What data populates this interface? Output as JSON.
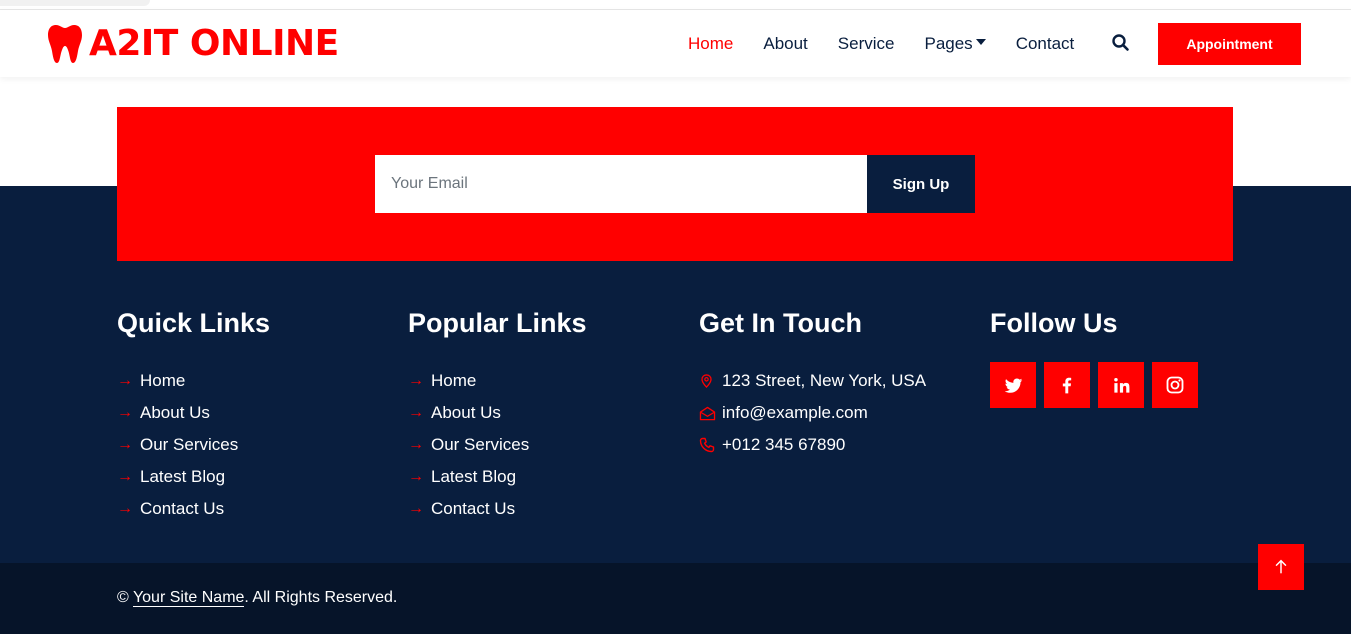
{
  "brand": {
    "name": "A2IT ONLINE",
    "icon": "tooth-icon",
    "color": "#ff0000"
  },
  "nav": {
    "items": [
      {
        "label": "Home",
        "active": true
      },
      {
        "label": "About",
        "active": false
      },
      {
        "label": "Service",
        "active": false
      },
      {
        "label": "Pages",
        "active": false,
        "dropdown": true
      },
      {
        "label": "Contact",
        "active": false
      }
    ],
    "search_icon": "search-icon",
    "appointment_label": "Appointment"
  },
  "newsletter": {
    "email_placeholder": "Your Email",
    "signup_label": "Sign Up"
  },
  "footer": {
    "quick_links": {
      "title": "Quick Links",
      "items": [
        "Home",
        "About Us",
        "Our Services",
        "Latest Blog",
        "Contact Us"
      ]
    },
    "popular_links": {
      "title": "Popular Links",
      "items": [
        "Home",
        "About Us",
        "Our Services",
        "Latest Blog",
        "Contact Us"
      ]
    },
    "contact": {
      "title": "Get In Touch",
      "address": "123 Street, New York, USA",
      "email": "info@example.com",
      "phone": "+012 345 67890"
    },
    "follow": {
      "title": "Follow Us",
      "networks": [
        "twitter",
        "facebook",
        "linkedin",
        "instagram"
      ]
    },
    "copyright_prefix": "©",
    "site_name": "Your Site Name",
    "copyright_suffix": ". All Rights Reserved."
  },
  "colors": {
    "primary": "#ff0000",
    "dark": "#091e3e",
    "darker": "#061429"
  }
}
